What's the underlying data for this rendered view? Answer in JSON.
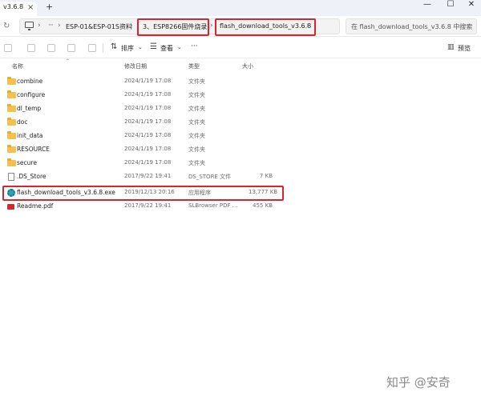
{
  "tab": {
    "title": "v3.6.8",
    "close": "×",
    "new": "+"
  },
  "window_controls": {
    "minimize": "—",
    "maximize": "☐",
    "close": "✕"
  },
  "nav": {
    "back": "←",
    "forward": "→",
    "up": "↑",
    "refresh": "↻"
  },
  "breadcrumbs": [
    {
      "label": "ESP-01&ESP-01S资料"
    },
    {
      "label": "3、ESP8266固件烧录"
    },
    {
      "label": "flash_download_tools_v3.6.8"
    }
  ],
  "breadcrumb_sep": "›",
  "search": {
    "placeholder": "在 flash_download_tools_v3.6.8 中搜索"
  },
  "toolbar": {
    "sort": "排序",
    "view": "查看",
    "more": "···",
    "preview": "预览"
  },
  "columns": {
    "name": "名称",
    "date": "修改日期",
    "type": "类型",
    "size": "大小"
  },
  "files": [
    {
      "name": "combine",
      "date": "2024/1/19 17:08",
      "type": "文件夹",
      "size": "",
      "icon": "folder-icon"
    },
    {
      "name": "configure",
      "date": "2024/1/19 17:08",
      "type": "文件夹",
      "size": "",
      "icon": "folder-icon"
    },
    {
      "name": "dl_temp",
      "date": "2024/1/19 17:08",
      "type": "文件夹",
      "size": "",
      "icon": "folder-icon"
    },
    {
      "name": "doc",
      "date": "2024/1/19 17:08",
      "type": "文件夹",
      "size": "",
      "icon": "folder-icon"
    },
    {
      "name": "init_data",
      "date": "2024/1/19 17:08",
      "type": "文件夹",
      "size": "",
      "icon": "folder-icon"
    },
    {
      "name": "RESOURCE",
      "date": "2024/1/19 17:08",
      "type": "文件夹",
      "size": "",
      "icon": "folder-icon"
    },
    {
      "name": "secure",
      "date": "2024/1/19 17:08",
      "type": "文件夹",
      "size": "",
      "icon": "folder-icon"
    },
    {
      "name": ".DS_Store",
      "date": "2017/9/22 19:41",
      "type": "DS_STORE 文件",
      "size": "7 KB",
      "icon": "document-icon"
    },
    {
      "name": "flash_download_tools_v3.6.8.exe",
      "date": "2019/12/13 20:16",
      "type": "应用程序",
      "size": "13,777 KB",
      "icon": "application-icon"
    },
    {
      "name": "Readme.pdf",
      "date": "2017/9/22 19:41",
      "type": "SLBrowser PDF ...",
      "size": "455 KB",
      "icon": "pdf-icon"
    }
  ],
  "watermark": "知乎 @安奇",
  "colors": {
    "highlight": "#d9262c",
    "folder": "#f2c14e",
    "titlebar": "#eef1f7"
  }
}
